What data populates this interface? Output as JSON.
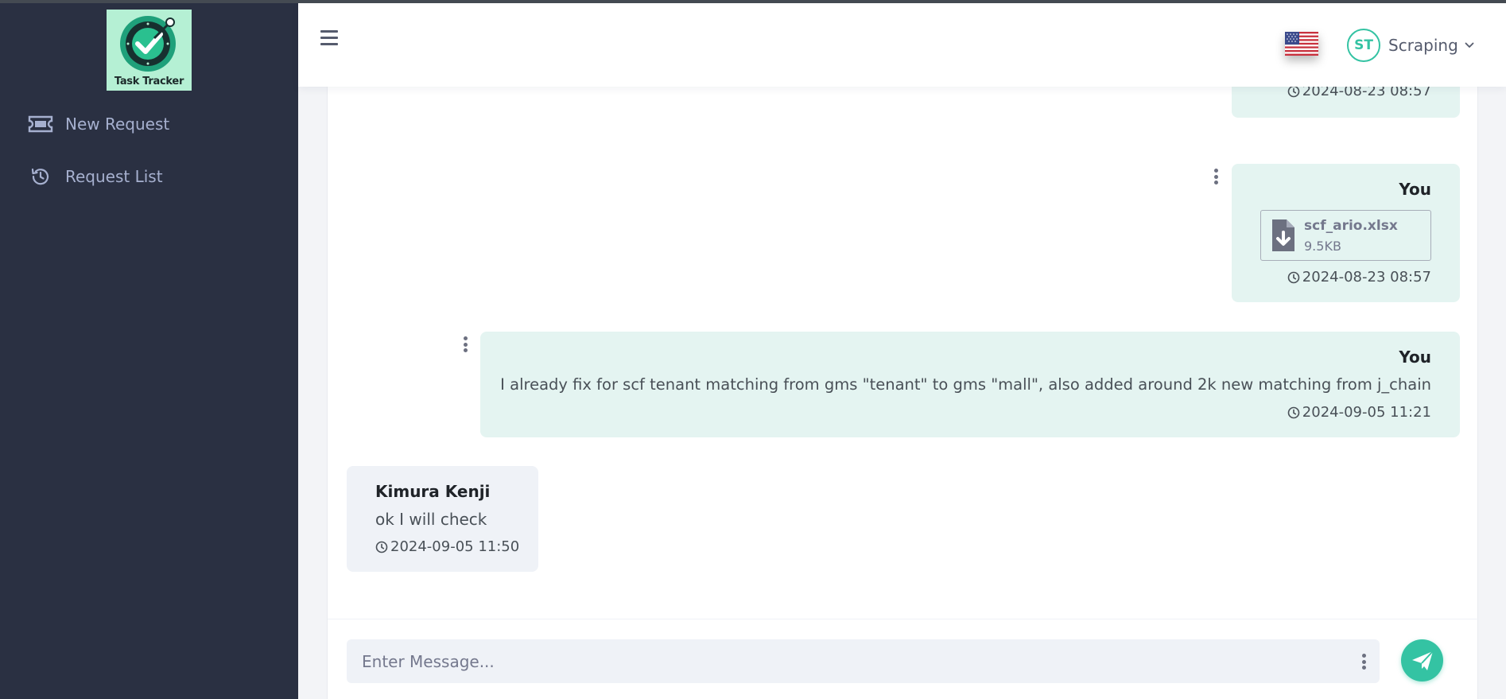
{
  "app": {
    "logo_text": "Task Tracker"
  },
  "sidebar": {
    "items": [
      {
        "label": "New Request",
        "icon": "ticket-icon"
      },
      {
        "label": "Request List",
        "icon": "history-icon"
      }
    ]
  },
  "header": {
    "language_flag": "us-flag-icon",
    "user": {
      "initials": "ST",
      "name": "Scraping"
    }
  },
  "chat": {
    "messages": [
      {
        "author": "",
        "time": "2024-08-23 08:57",
        "mine": true,
        "partially_visible": true
      },
      {
        "author": "You",
        "file": {
          "name": "scf_ario.xlsx",
          "size": "9.5KB"
        },
        "time": "2024-08-23 08:57",
        "mine": true
      },
      {
        "author": "You",
        "text": "I already fix for scf tenant matching from gms \"tenant\" to gms \"mall\", also added around 2k new matching from j_chain",
        "time": "2024-09-05 11:21",
        "mine": true
      },
      {
        "author": "Kimura Kenji",
        "text": "ok I will check",
        "time": "2024-09-05 11:50",
        "mine": false
      }
    ],
    "input": {
      "placeholder": "Enter Message..."
    }
  },
  "colors": {
    "sidebar": "#2a3042",
    "accent": "#34c3a3",
    "mine_bubble": "#e4f4f1",
    "other_bubble": "#eff2f7"
  }
}
